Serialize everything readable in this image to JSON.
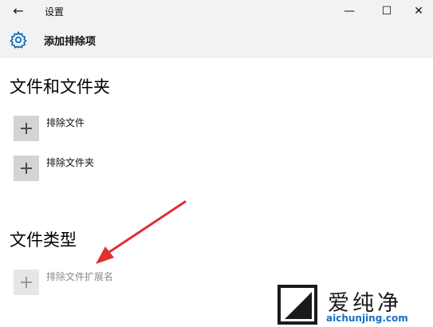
{
  "window": {
    "title": "设置",
    "back_icon": "back-arrow-icon",
    "minimize_glyph": "—",
    "maximize_glyph": "☐",
    "close_glyph": "✕"
  },
  "header": {
    "icon": "gear-icon",
    "title": "添加排除项",
    "accent_color": "#0063b1"
  },
  "sections": {
    "files_folders": {
      "title": "文件和文件夹",
      "items": [
        {
          "label": "排除文件"
        },
        {
          "label": "排除文件夹"
        }
      ]
    },
    "file_types": {
      "title": "文件类型",
      "items": [
        {
          "label": "排除文件扩展名"
        }
      ]
    }
  },
  "annotation": {
    "arrow_color": "#e03030"
  },
  "watermark": {
    "name": "爱纯净",
    "url": "aichunjing.com"
  }
}
